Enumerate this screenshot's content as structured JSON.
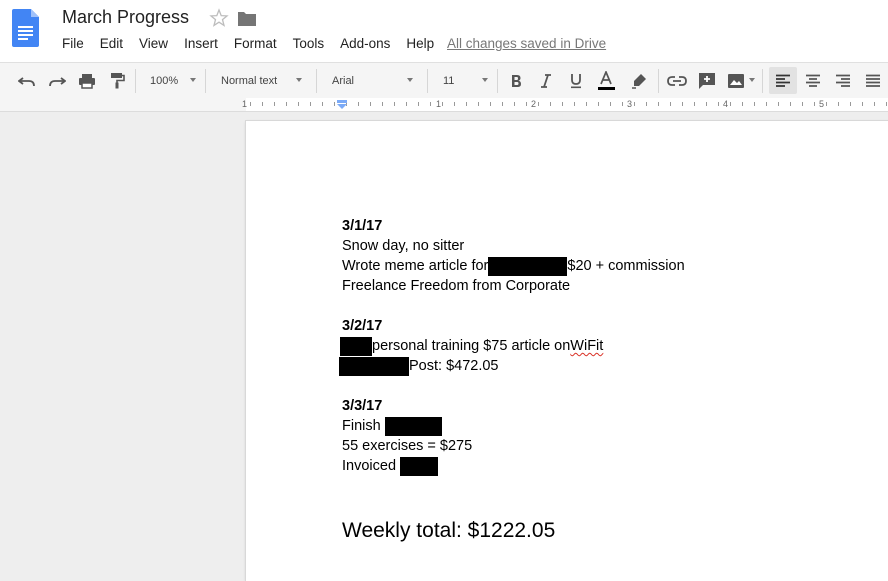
{
  "header": {
    "title": "March Progress",
    "saved_status": "All changes saved in Drive",
    "menu": [
      "File",
      "Edit",
      "View",
      "Insert",
      "Format",
      "Tools",
      "Add-ons",
      "Help"
    ]
  },
  "toolbar": {
    "zoom": "100%",
    "style": "Normal text",
    "font": "Arial",
    "font_size": "11",
    "text_color": "#000000",
    "icons": [
      "undo-icon",
      "redo-icon",
      "print-icon",
      "paint-format-icon",
      "bold-icon",
      "italic-icon",
      "underline-icon",
      "text-color-icon",
      "highlight-icon",
      "link-icon",
      "comment-icon",
      "image-icon",
      "align-left-icon",
      "align-center-icon",
      "align-right-icon",
      "justify-icon"
    ]
  },
  "ruler": {
    "numbers": [
      "1",
      "1",
      "2",
      "3",
      "4",
      "5"
    ]
  },
  "document": {
    "entries": [
      {
        "date": "3/1/17",
        "lines": [
          {
            "text": "Snow day, no sitter"
          },
          {
            "before": "Wrote meme article for",
            "after": " $20 + commission"
          },
          {
            "text": "Freelance Freedom from Corporate"
          }
        ]
      },
      {
        "date": "3/2/17",
        "lines": [
          {
            "after": " personal training $75 article on ",
            "misspelled": "WiFit"
          },
          {
            "after": "Post: $472.05"
          }
        ]
      },
      {
        "date": "3/3/17",
        "lines": [
          {
            "before": "Finish "
          },
          {
            "text": "55 exercises = $275"
          },
          {
            "before": "Invoiced "
          }
        ]
      }
    ],
    "total": "Weekly total: $1222.05"
  },
  "colors": {
    "accent": "#4285f4",
    "page_bg": "#ffffff",
    "canvas_bg": "#eeeeee",
    "redaction": "#000000"
  }
}
